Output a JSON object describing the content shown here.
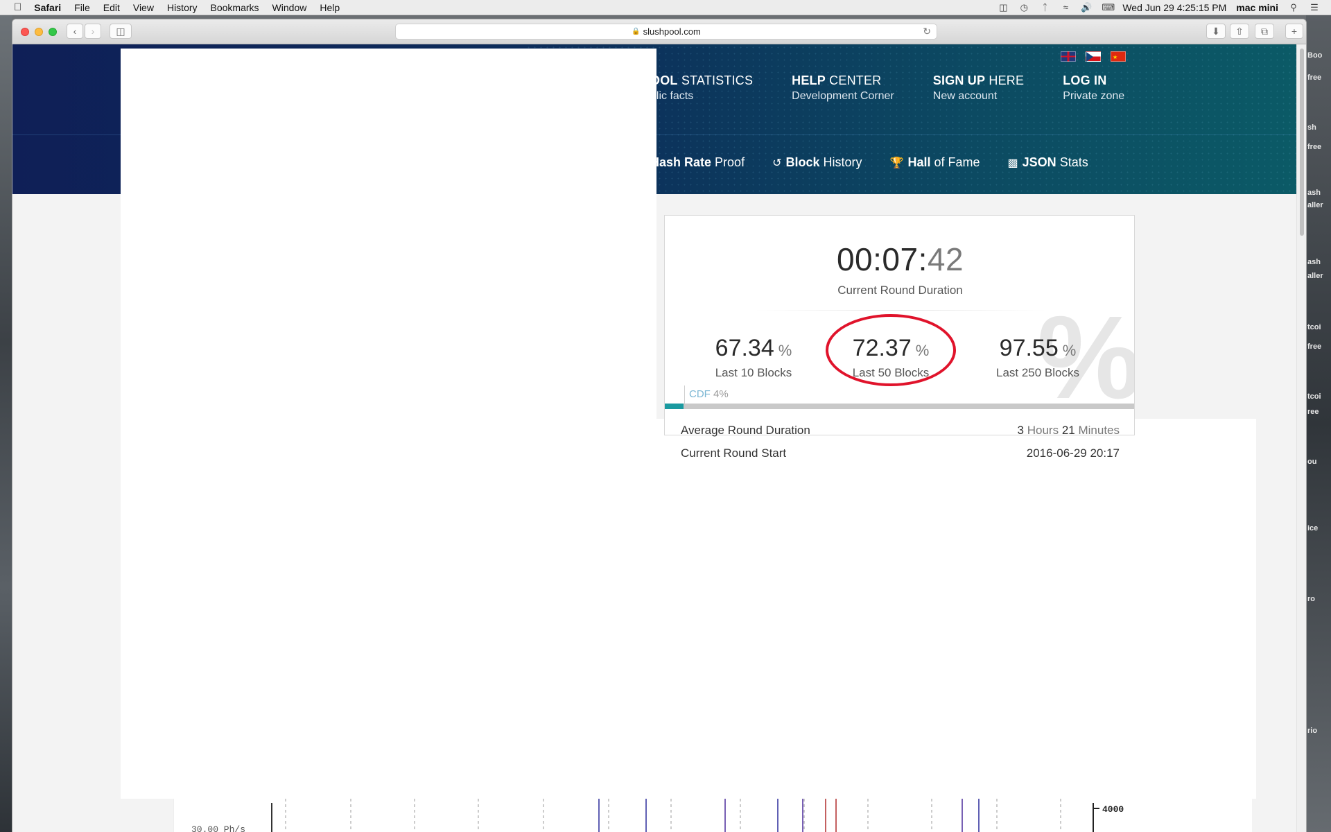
{
  "menubar": {
    "app": "Safari",
    "items": [
      "File",
      "Edit",
      "View",
      "History",
      "Bookmarks",
      "Window",
      "Help"
    ],
    "clock": "Wed Jun 29  4:25:15 PM",
    "user": "mac mini"
  },
  "browser": {
    "url": "slushpool.com"
  },
  "desktop_right_labels": [
    "Boo",
    "free",
    "sh",
    "free",
    "ash",
    "aller",
    "ash",
    "aller",
    "tcoi",
    "free",
    "tcoi",
    "ree",
    "ou",
    "ice",
    "ro",
    "rio"
  ],
  "nav": {
    "items": [
      {
        "bold": "OOL",
        "rest": "STATISTICS",
        "sub": "blic facts"
      },
      {
        "bold": "HELP",
        "rest": "CENTER",
        "sub": "Development Corner"
      },
      {
        "bold": "SIGN UP",
        "rest": "HERE",
        "sub": "New account"
      },
      {
        "bold": "LOG IN",
        "rest": "",
        "sub": "Private zone"
      }
    ]
  },
  "subnav": {
    "items": [
      {
        "bold": "Hash Rate",
        "rest": "Proof"
      },
      {
        "bold": "Block",
        "rest": "History"
      },
      {
        "bold": "Hall",
        "rest": "of Fame"
      },
      {
        "bold": "JSON",
        "rest": "Stats"
      }
    ]
  },
  "stats": {
    "timer_main": "00:07:",
    "timer_sec": "42",
    "timer_label": "Current Round Duration",
    "blocks": [
      {
        "value": "67.34",
        "unit": "%",
        "label": "Last 10 Blocks"
      },
      {
        "value": "72.37",
        "unit": "%",
        "label": "Last 50 Blocks"
      },
      {
        "value": "97.55",
        "unit": "%",
        "label": "Last 250 Blocks"
      }
    ],
    "cdf_key": "CDF",
    "cdf_value": "4%",
    "cdf_fraction": 0.04,
    "avg_label": "Average Round Duration",
    "avg_hours": "3",
    "avg_hours_unit": "Hours",
    "avg_minutes": "21",
    "avg_minutes_unit": "Minutes",
    "start_label": "Current Round Start",
    "start_value": "2016-06-29 20:17"
  },
  "chart_strip": {
    "right_label": "4000",
    "left_label": "30.00 Ph/s"
  },
  "colors": {
    "accent_teal": "#1a9aa0",
    "highlight_red": "#e0132b",
    "hero_navy": "#0f1f57"
  }
}
